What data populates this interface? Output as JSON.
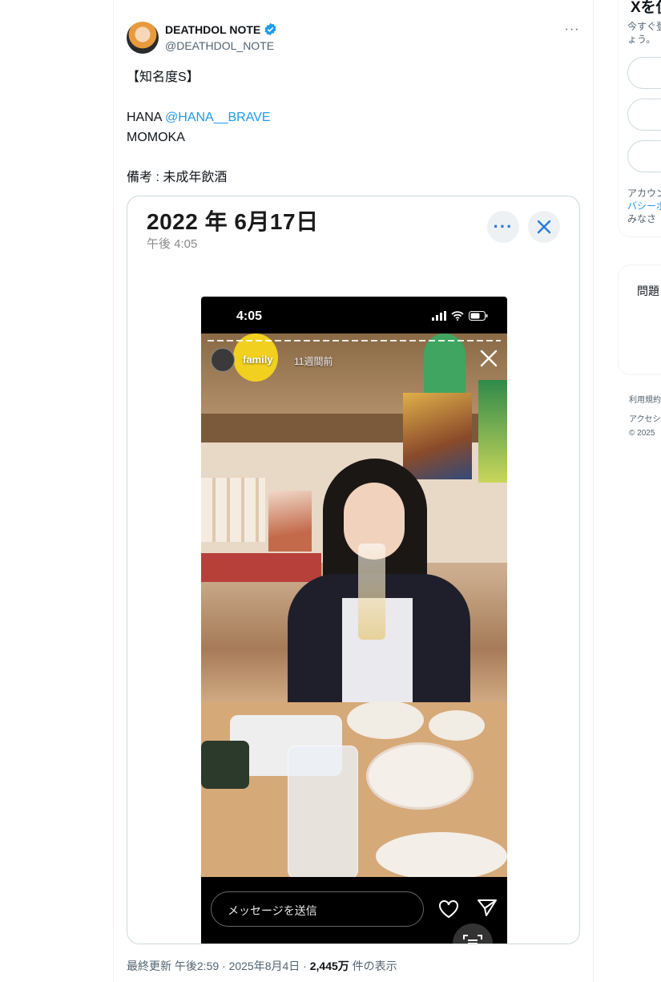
{
  "tweet": {
    "display_name": "DEATHDOL NOTE",
    "handle": "@DEATHDOL_NOTE",
    "verified": true,
    "more_label": "···",
    "lines": [
      "【知名度S】",
      "",
      "HANA ",
      "MOMOKA",
      "",
      "備考 : 未成年飲酒"
    ],
    "mention": "@HANA__BRAVE",
    "meta": {
      "updated": "最終更新 午後2:59 · 2025年8月4日 · ",
      "views": "2,445万",
      "views_suffix": " 件の表示"
    }
  },
  "media": {
    "date_title": "2022 年 6月17日",
    "time": "午後 4:05",
    "phone": {
      "status_time": "4:05",
      "story_user": "family",
      "story_age": "11週間前",
      "message_placeholder": "メッセージを送信"
    }
  },
  "right_column": {
    "heading": "Xを使",
    "line1": "今すぐ登",
    "line2": "ょう。",
    "line3": "アカウン",
    "line4": "バシーポ",
    "line5": "みなさ",
    "card_title": "問題",
    "footer1": "利用規約",
    "footer2": "アクセシ",
    "footer3": "© 2025"
  },
  "colors": {
    "accent": "#1d9bf0",
    "text": "#0f1419",
    "muted": "#536471",
    "border": "#cfd9de"
  }
}
